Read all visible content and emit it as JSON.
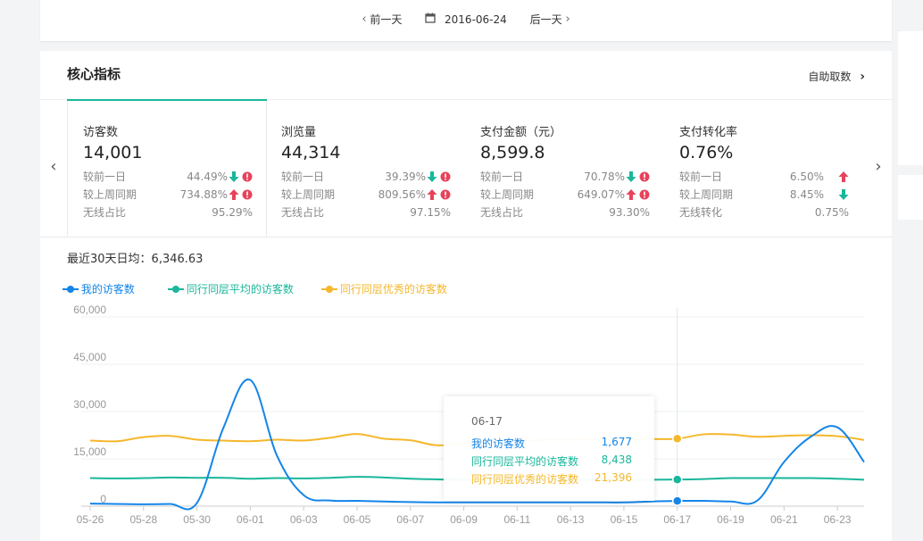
{
  "date_nav": {
    "prev_label": "前一天",
    "date": "2016-06-24",
    "next_label": "后一天",
    "prev_icon": "chevron-left-icon",
    "calendar_icon": "calendar-icon",
    "next_icon": "chevron-right-icon"
  },
  "header": {
    "title": "核心指标",
    "self_fetch_label": "自助取数",
    "self_fetch_icon": "chevron-right-icon"
  },
  "colors": {
    "accent": "#19b79b",
    "up": "#e8425b",
    "down": "#19b79b",
    "mine": "#1485e8",
    "avg": "#19b79b",
    "top": "#f5b72b"
  },
  "metrics": [
    {
      "title": "访客数",
      "value": "14,001",
      "active": true,
      "rows": [
        {
          "label": "较前一日",
          "value": "44.49%",
          "trend": "down",
          "alert": true
        },
        {
          "label": "较上周同期",
          "value": "734.88%",
          "trend": "up",
          "alert": true
        },
        {
          "label": "无线占比",
          "value": "95.29%",
          "trend": "",
          "alert": false
        }
      ]
    },
    {
      "title": "浏览量",
      "value": "44,314",
      "active": false,
      "rows": [
        {
          "label": "较前一日",
          "value": "39.39%",
          "trend": "down",
          "alert": true
        },
        {
          "label": "较上周同期",
          "value": "809.56%",
          "trend": "up",
          "alert": true
        },
        {
          "label": "无线占比",
          "value": "97.15%",
          "trend": "",
          "alert": false
        }
      ]
    },
    {
      "title": "支付金额（元）",
      "value": "8,599.8",
      "active": false,
      "rows": [
        {
          "label": "较前一日",
          "value": "70.78%",
          "trend": "down",
          "alert": true
        },
        {
          "label": "较上周同期",
          "value": "649.07%",
          "trend": "up",
          "alert": true
        },
        {
          "label": "无线占比",
          "value": "93.30%",
          "trend": "",
          "alert": false
        }
      ]
    },
    {
      "title": "支付转化率",
      "value": "0.76%",
      "active": false,
      "rows": [
        {
          "label": "较前一日",
          "value": "6.50%",
          "trend": "up",
          "alert": false
        },
        {
          "label": "较上周同期",
          "value": "8.45%",
          "trend": "down",
          "alert": false
        },
        {
          "label": "无线转化",
          "value": "0.75%",
          "trend": "",
          "alert": false
        }
      ]
    }
  ],
  "average_text": "最近30天日均：6,346.63",
  "chart_data": {
    "type": "line",
    "x": [
      "05-26",
      "05-27",
      "05-28",
      "05-29",
      "05-30",
      "05-31",
      "06-01",
      "06-02",
      "06-03",
      "06-04",
      "06-05",
      "06-06",
      "06-07",
      "06-08",
      "06-09",
      "06-10",
      "06-11",
      "06-12",
      "06-13",
      "06-14",
      "06-15",
      "06-16",
      "06-17",
      "06-18",
      "06-19",
      "06-20",
      "06-21",
      "06-22",
      "06-23",
      "06-24"
    ],
    "x_ticks": [
      "05-26",
      "05-28",
      "05-30",
      "06-01",
      "06-03",
      "06-05",
      "06-07",
      "06-09",
      "06-11",
      "06-13",
      "06-15",
      "06-17",
      "06-19",
      "06-21",
      "06-23"
    ],
    "y_ticks": [
      "60,000",
      "45,000",
      "30,000",
      "15,000",
      "0"
    ],
    "ylim": [
      0,
      60000
    ],
    "legend_position": "top-left",
    "grid": true,
    "series": [
      {
        "name": "我的访客数",
        "color": "#1485e8",
        "values": [
          800,
          700,
          600,
          700,
          1000,
          25000,
          40000,
          16000,
          3500,
          1800,
          1700,
          1500,
          1300,
          1200,
          1200,
          1200,
          1200,
          1200,
          1200,
          1200,
          1200,
          1500,
          1677,
          1700,
          1500,
          1800,
          14000,
          22000,
          25000,
          14001
        ]
      },
      {
        "name": "同行同层平均的访客数",
        "color": "#19b79b",
        "values": [
          8900,
          8800,
          8900,
          9100,
          9000,
          9000,
          8700,
          8900,
          8800,
          9000,
          9300,
          9100,
          8700,
          8500,
          8400,
          8400,
          8400,
          8400,
          8400,
          8400,
          8400,
          8400,
          8438,
          8600,
          8900,
          8900,
          8900,
          8900,
          8700,
          8400
        ]
      },
      {
        "name": "同行同层优秀的访客数",
        "color": "#f5b72b",
        "values": [
          20800,
          20600,
          21900,
          22300,
          21100,
          20800,
          20600,
          21100,
          20800,
          21700,
          22900,
          21400,
          20900,
          19300,
          20000,
          20500,
          20800,
          21000,
          21000,
          21100,
          21200,
          21300,
          21396,
          22800,
          22700,
          22000,
          22300,
          22500,
          22200,
          21000
        ]
      }
    ],
    "highlight_index": 22,
    "tooltip": {
      "date": "06-17",
      "rows": [
        {
          "name": "我的访客数",
          "value": "1,677"
        },
        {
          "name": "同行同层平均的访客数",
          "value": "8,438"
        },
        {
          "name": "同行同层优秀的访客数",
          "value": "21,396"
        }
      ]
    }
  }
}
